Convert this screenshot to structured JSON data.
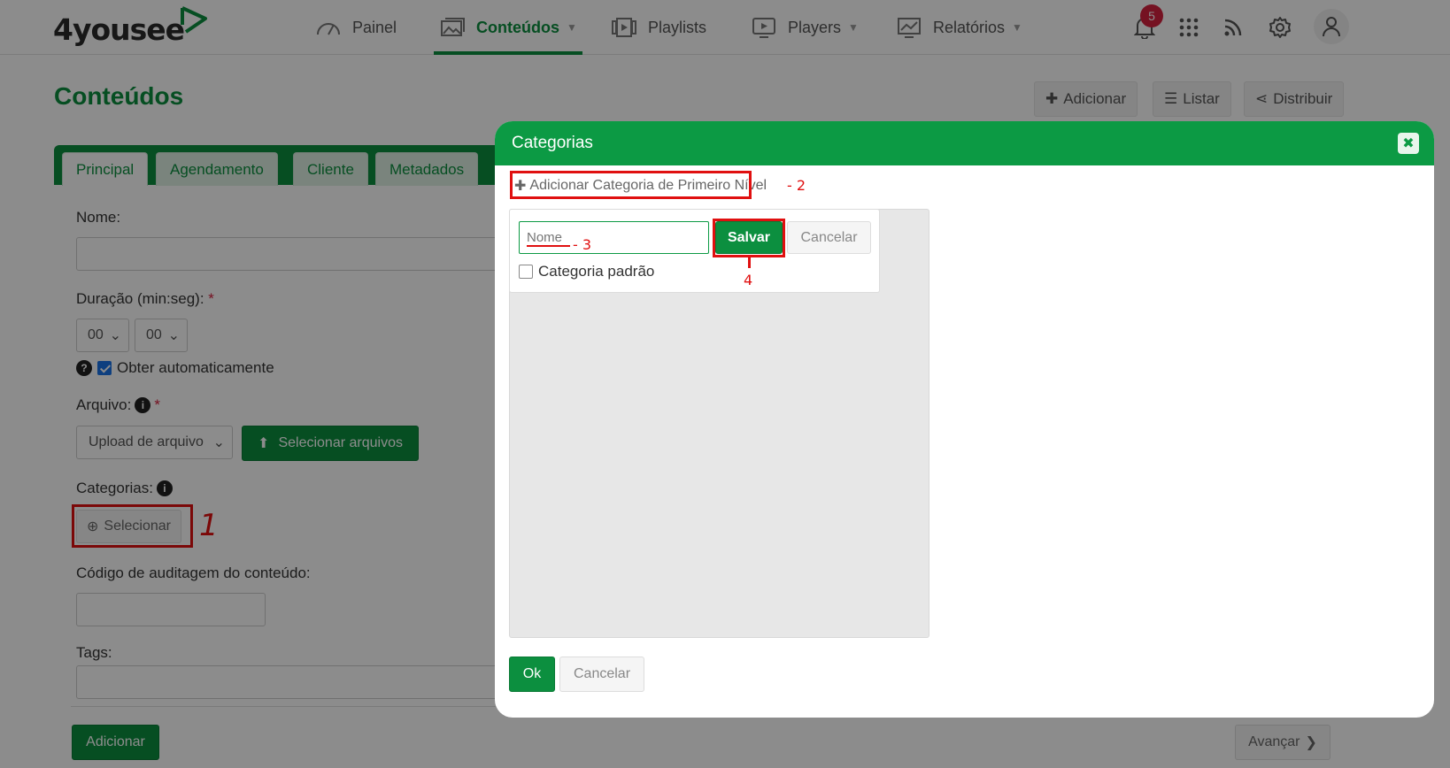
{
  "app": {
    "logo": "4yousee"
  },
  "nav": {
    "items": [
      {
        "label": "Painel",
        "icon": "speedometer-icon",
        "active": false,
        "caret": false
      },
      {
        "label": "Conteúdos",
        "icon": "image-stack-icon",
        "active": true,
        "caret": true
      },
      {
        "label": "Playlists",
        "icon": "playlist-icon",
        "active": false,
        "caret": false
      },
      {
        "label": "Players",
        "icon": "monitor-play-icon",
        "active": false,
        "caret": true
      },
      {
        "label": "Relatórios",
        "icon": "chart-icon",
        "active": false,
        "caret": true
      }
    ],
    "notifications_count": "5",
    "right_icons": [
      "bell-icon",
      "apps-grid-icon",
      "rss-icon",
      "gear-icon",
      "user-icon"
    ]
  },
  "page": {
    "title": "Conteúdos",
    "actions": {
      "add": "Adicionar",
      "list": "Listar",
      "distribute": "Distribuir"
    },
    "tabs": [
      "Principal",
      "Agendamento",
      "Cliente",
      "Metadados"
    ],
    "form": {
      "name_label": "Nome:",
      "duration_label": "Duração (min:seg):",
      "required_mark": "*",
      "minutes_value": "00",
      "seconds_value": "00",
      "auto_label": "Obter automaticamente",
      "file_label": "Arquivo:",
      "file_source_value": "Upload de arquivo",
      "select_files_label": "Selecionar arquivos",
      "categories_label": "Categorias:",
      "select_label": "Selecionar",
      "audit_label": "Código de auditagem do conteúdo:",
      "tags_label": "Tags:",
      "add_button": "Adicionar",
      "next_button": "Avançar"
    }
  },
  "modal": {
    "title": "Categorias",
    "add_top_level": "Adicionar Categoria de Primeiro Nível",
    "name_placeholder": "Nome",
    "save_button": "Salvar",
    "cancel_inline": "Cancelar",
    "default_category": "Categoria padrão",
    "ok_button": "Ok",
    "cancel_button": "Cancelar"
  },
  "annotations": {
    "one": "1",
    "two": "- 2",
    "three": "- 3",
    "four": "4",
    "color": "#e01010"
  },
  "colors": {
    "brand_green": "#0c8f3f",
    "header_green": "#0c9a44",
    "badge_red": "#d6213f"
  }
}
